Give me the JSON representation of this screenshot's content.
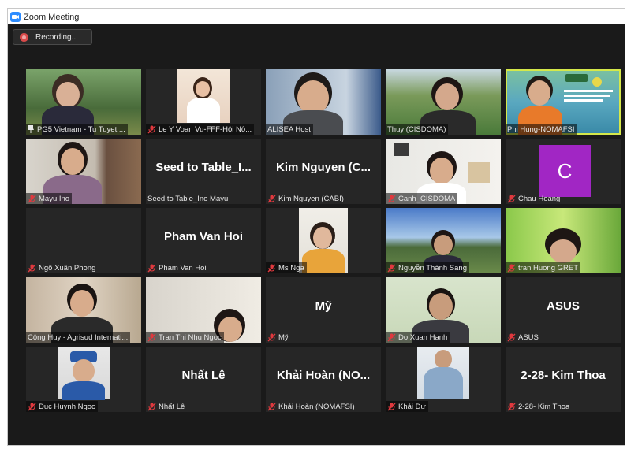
{
  "app": {
    "title": "Zoom Meeting"
  },
  "recording": {
    "label": "Recording..."
  },
  "tiles": [
    {
      "name": "PG5 Vietnam - Tu Tuyet ..."
    },
    {
      "name": "Le Y Voan Vu-FFF-Hội Nô..."
    },
    {
      "name": "ALISEA Host"
    },
    {
      "name": "Thuy (CISDOMA)"
    },
    {
      "name": "Phi Hung-NOMAFSI"
    },
    {
      "name": "Mayu Ino"
    },
    {
      "name": "Seed to Table_Ino Mayu",
      "big": "Seed to Table_I..."
    },
    {
      "name": "Kim Nguyen (CABI)",
      "big": "Kim Nguyen (C..."
    },
    {
      "name": "Canh_CISDOMA"
    },
    {
      "name": "Chau Hoang",
      "initial": "C"
    },
    {
      "name": "Ngô Xuân Phong"
    },
    {
      "name": "Pham Van Hoi",
      "big": "Pham Van Hoi"
    },
    {
      "name": "Ms Nga"
    },
    {
      "name": "Nguyễn Thành Sang"
    },
    {
      "name": "tran Huong GRET"
    },
    {
      "name": "Công Huy - Agrisud Internati..."
    },
    {
      "name": "Tran Thi Nhu Ngoc"
    },
    {
      "name": "Mỹ",
      "big": "Mỹ"
    },
    {
      "name": "Do Xuan Hanh"
    },
    {
      "name": "ASUS",
      "big": "ASUS"
    },
    {
      "name": "Duc Huynh Ngoc"
    },
    {
      "name": "Nhất Lê",
      "big": "Nhất Lê"
    },
    {
      "name": "Khải Hoàn (NOMAFSI)",
      "big": "Khải Hoàn (NO..."
    },
    {
      "name": "Khải Dư"
    },
    {
      "name": "2-28- Kim Thoa",
      "big": "2-28- Kim Thoa"
    }
  ],
  "colors": {
    "tile_bg": "#262626",
    "active_border": "#d5e84a",
    "mute_red": "#e0393e",
    "avatar_purple": "#a126c4"
  }
}
